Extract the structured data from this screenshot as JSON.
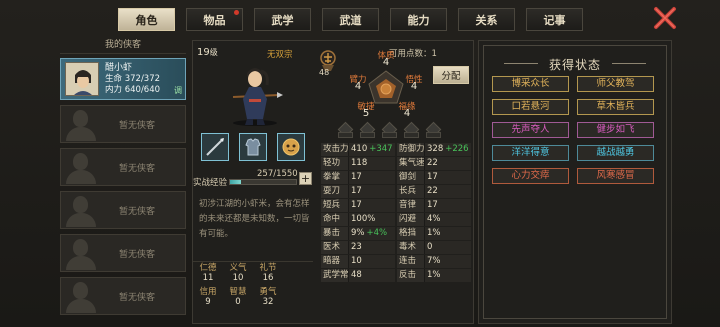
{
  "tabs": [
    {
      "label": "角色",
      "active": true,
      "notify": false
    },
    {
      "label": "物品",
      "active": false,
      "notify": true
    },
    {
      "label": "武学",
      "active": false,
      "notify": false
    },
    {
      "label": "武道",
      "active": false,
      "notify": false
    },
    {
      "label": "能力",
      "active": false,
      "notify": false
    },
    {
      "label": "关系",
      "active": false,
      "notify": false
    },
    {
      "label": "记事",
      "active": false,
      "notify": false
    }
  ],
  "left": {
    "title": "我的侠客",
    "hero": {
      "name": "醋小虾",
      "hp_label": "生命",
      "hp": "372/372",
      "mp_label": "内力",
      "mp": "640/640",
      "tag": "调"
    },
    "empty_slots": [
      "暂无侠客",
      "暂无侠客",
      "暂无侠客",
      "暂无侠客",
      "暂无侠客"
    ]
  },
  "character": {
    "level": "19",
    "level_unit": "级",
    "sect": "无双宗",
    "coin_count": "48",
    "points_label": "可用点数：",
    "points_value": "1",
    "assign_label": "分配",
    "stats": {
      "tizhi": {
        "label": "体质",
        "value": "4"
      },
      "biali": {
        "label": "臂力",
        "value": "4"
      },
      "wuxing": {
        "label": "悟性",
        "value": "4"
      },
      "minjie": {
        "label": "敏捷",
        "value": "5"
      },
      "fuyuan": {
        "label": "福缘",
        "value": "4"
      }
    },
    "exp_label": "实战经验",
    "exp_text": "257/1550",
    "exp_fraction": 0.166,
    "description": "初涉江湖的小虾米，会有怎样的未来还都是未知数，一切皆有可能。",
    "virtues": [
      [
        {
          "k": "仁德",
          "v": "11"
        },
        {
          "k": "义气",
          "v": "10"
        },
        {
          "k": "礼节",
          "v": "16"
        }
      ],
      [
        {
          "k": "信用",
          "v": "9"
        },
        {
          "k": "智慧",
          "v": "0"
        },
        {
          "k": "勇气",
          "v": "32"
        }
      ]
    ],
    "attributes": [
      [
        {
          "k": "攻击力",
          "v": "410",
          "b": "+347"
        },
        {
          "k": "防御力",
          "v": "328",
          "b": "+226"
        }
      ],
      [
        {
          "k": "轻功",
          "v": "118",
          "b": ""
        },
        {
          "k": "集气速度",
          "v": "22",
          "b": ""
        }
      ],
      [
        {
          "k": "拳掌",
          "v": "17",
          "b": ""
        },
        {
          "k": "御剑",
          "v": "17",
          "b": ""
        }
      ],
      [
        {
          "k": "耍刀",
          "v": "17",
          "b": ""
        },
        {
          "k": "长兵",
          "v": "22",
          "b": ""
        }
      ],
      [
        {
          "k": "短兵",
          "v": "17",
          "b": ""
        },
        {
          "k": "音律",
          "v": "17",
          "b": ""
        }
      ],
      [
        {
          "k": "命中",
          "v": "100%",
          "b": ""
        },
        {
          "k": "闪避",
          "v": "4%",
          "b": ""
        }
      ],
      [
        {
          "k": "暴击",
          "v": "9%",
          "b": "+4%"
        },
        {
          "k": "格挡",
          "v": "1%",
          "b": ""
        }
      ],
      [
        {
          "k": "医术",
          "v": "23",
          "b": ""
        },
        {
          "k": "毒术",
          "v": "0",
          "b": ""
        }
      ],
      [
        {
          "k": "暗器",
          "v": "10",
          "b": ""
        },
        {
          "k": "连击",
          "v": "7%",
          "b": ""
        }
      ],
      [
        {
          "k": "武学常识",
          "v": "48",
          "b": ""
        },
        {
          "k": "反击",
          "v": "1%",
          "b": ""
        }
      ]
    ]
  },
  "status": {
    "title": "获得状态",
    "badges": [
      {
        "label": "博采众长",
        "color": "gold"
      },
      {
        "label": "师父教驾",
        "color": "gold"
      },
      {
        "label": "口若悬河",
        "color": "gold"
      },
      {
        "label": "草木皆兵",
        "color": "gold"
      },
      {
        "label": "先声夺人",
        "color": "pink"
      },
      {
        "label": "健步如飞",
        "color": "pink"
      },
      {
        "label": "洋洋得意",
        "color": "cyan"
      },
      {
        "label": "越战越勇",
        "color": "cyan"
      },
      {
        "label": "心力交瘁",
        "color": "red"
      },
      {
        "label": "风寒感冒",
        "color": "red"
      }
    ]
  },
  "colors": {
    "accent": "#e9dfc8",
    "gold": "#e2b35a",
    "pink": "#d95cc0",
    "cyan": "#4fc5e0",
    "red": "#e06a4a",
    "bonus": "#48c25a",
    "stat_label": "#e07a3a"
  }
}
